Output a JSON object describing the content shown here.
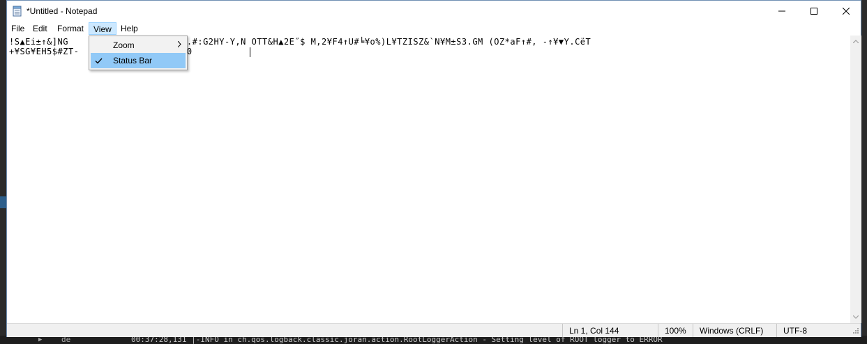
{
  "background": {
    "terminal_tab": "de",
    "terminal_log": "00:37:28,131 |-INFO in ch.qos.logback.classic.joran.action.RootLoggerAction - Setting level of ROOT logger to ERROR"
  },
  "window": {
    "title": "*Untitled - Notepad",
    "icons": {
      "app": "notepad-icon",
      "minimize": "minimize-icon",
      "maximize": "maximize-icon",
      "close": "close-icon"
    }
  },
  "menubar": {
    "file": "File",
    "edit": "Edit",
    "format": "Format",
    "view": "View",
    "help": "Help",
    "active": "View"
  },
  "view_menu": {
    "zoom": "Zoom",
    "status_bar": "Status Bar",
    "status_bar_checked": true
  },
  "editor": {
    "line1": "!S▲Ei±↑&]NG                9 ▲N!;.#:G2HY-Y,N OTT&H▲2E˝$ M,2¥F4↑U#╘¥o%)L¥TZISZ&`N¥M±S3.GM (OZ*aF↑#, -↑¥▼Y.CëT",
    "line2": "+¥SG¥EH5$#ZT-             b.←-▲ +0"
  },
  "status": {
    "position": "Ln 1, Col 144",
    "zoom": "100%",
    "line_ending": "Windows (CRLF)",
    "encoding": "UTF-8"
  },
  "colors": {
    "menu_active_bg": "#cce8ff",
    "menu_active_border": "#99d1ff",
    "dropdown_highlight": "#91c9f7",
    "statusbar_bg": "#f0f0f0"
  }
}
